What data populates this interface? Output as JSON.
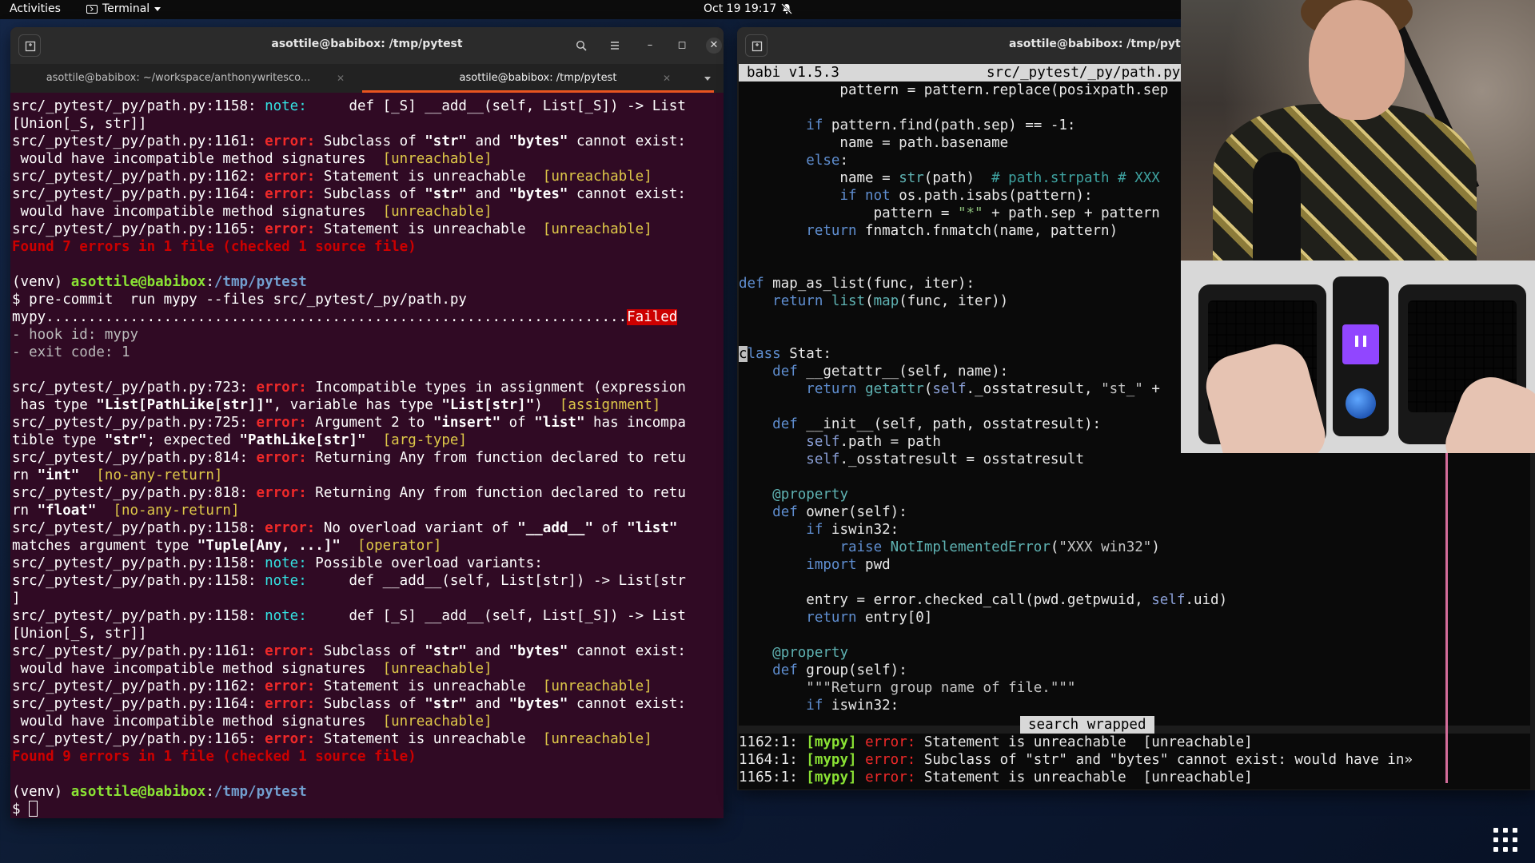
{
  "topbar": {
    "activities": "Activities",
    "app_menu": "Terminal",
    "clock": "Oct 19  19:17",
    "icons": [
      "terminal-icon",
      "bell-muted-icon"
    ]
  },
  "left_window": {
    "title": "asottile@babibox: /tmp/pytest",
    "tabs": [
      {
        "label": "asottile@babibox: ~/workspace/anthonywritesco..."
      },
      {
        "label": "asottile@babibox: /tmp/pytest",
        "active": true
      }
    ],
    "lines": [
      [
        [
          "w",
          "src/_pytest/_py/path.py:1158: "
        ],
        [
          "note",
          "note:"
        ],
        [
          "w",
          "     def [_S] __add__(self, List[_S]) -> List"
        ]
      ],
      [
        [
          "w",
          "[Union[_S, str]]"
        ]
      ],
      [
        [
          "w",
          "src/_pytest/_py/path.py:1161: "
        ],
        [
          "err",
          "error:"
        ],
        [
          "w",
          " Subclass of "
        ],
        [
          "bold",
          "\"str\""
        ],
        [
          "w",
          " and "
        ],
        [
          "bold",
          "\"bytes\""
        ],
        [
          "w",
          " cannot exist:"
        ]
      ],
      [
        [
          "w",
          " would have incompatible method signatures  "
        ],
        [
          "tag",
          "[unreachable]"
        ]
      ],
      [
        [
          "w",
          "src/_pytest/_py/path.py:1162: "
        ],
        [
          "err",
          "error:"
        ],
        [
          "w",
          " Statement is unreachable  "
        ],
        [
          "tag",
          "[unreachable]"
        ]
      ],
      [
        [
          "w",
          "src/_pytest/_py/path.py:1164: "
        ],
        [
          "err",
          "error:"
        ],
        [
          "w",
          " Subclass of "
        ],
        [
          "bold",
          "\"str\""
        ],
        [
          "w",
          " and "
        ],
        [
          "bold",
          "\"bytes\""
        ],
        [
          "w",
          " cannot exist:"
        ]
      ],
      [
        [
          "w",
          " would have incompatible method signatures  "
        ],
        [
          "tag",
          "[unreachable]"
        ]
      ],
      [
        [
          "w",
          "src/_pytest/_py/path.py:1165: "
        ],
        [
          "err",
          "error:"
        ],
        [
          "w",
          " Statement is unreachable  "
        ],
        [
          "tag",
          "[unreachable]"
        ]
      ],
      [
        [
          "found",
          "Found 7 errors in 1 file (checked 1 source file)"
        ]
      ],
      [
        [
          "w",
          ""
        ]
      ],
      [
        [
          "w",
          "(venv) "
        ],
        [
          "green",
          "asottile@babibox"
        ],
        [
          "w",
          ":"
        ],
        [
          "blue",
          "/tmp/pytest"
        ]
      ],
      [
        [
          "w",
          "$ pre-commit  run mypy --files src/_pytest/_py/path.py"
        ]
      ],
      [
        [
          "w",
          "mypy....................................................................."
        ],
        [
          "failed",
          "Failed"
        ]
      ],
      [
        [
          "dim",
          "- hook id: mypy"
        ]
      ],
      [
        [
          "dim",
          "- exit code: 1"
        ]
      ],
      [
        [
          "w",
          ""
        ]
      ],
      [
        [
          "w",
          "src/_pytest/_py/path.py:723: "
        ],
        [
          "err",
          "error:"
        ],
        [
          "w",
          " Incompatible types in assignment (expression"
        ]
      ],
      [
        [
          "w",
          " has type "
        ],
        [
          "bold",
          "\"List[PathLike[str]]\""
        ],
        [
          "w",
          ", variable has type "
        ],
        [
          "bold",
          "\"List[str]\""
        ],
        [
          "w",
          ")  "
        ],
        [
          "tag",
          "[assignment]"
        ]
      ],
      [
        [
          "w",
          "src/_pytest/_py/path.py:725: "
        ],
        [
          "err",
          "error:"
        ],
        [
          "w",
          " Argument 2 to "
        ],
        [
          "bold",
          "\"insert\""
        ],
        [
          "w",
          " of "
        ],
        [
          "bold",
          "\"list\""
        ],
        [
          "w",
          " has incompa"
        ]
      ],
      [
        [
          "w",
          "tible type "
        ],
        [
          "bold",
          "\"str\""
        ],
        [
          "w",
          "; expected "
        ],
        [
          "bold",
          "\"PathLike[str]\""
        ],
        [
          "w",
          "  "
        ],
        [
          "tag",
          "[arg-type]"
        ]
      ],
      [
        [
          "w",
          "src/_pytest/_py/path.py:814: "
        ],
        [
          "err",
          "error:"
        ],
        [
          "w",
          " Returning Any from function declared to retu"
        ]
      ],
      [
        [
          "w",
          "rn "
        ],
        [
          "bold",
          "\"int\""
        ],
        [
          "w",
          "  "
        ],
        [
          "tag",
          "[no-any-return]"
        ]
      ],
      [
        [
          "w",
          "src/_pytest/_py/path.py:818: "
        ],
        [
          "err",
          "error:"
        ],
        [
          "w",
          " Returning Any from function declared to retu"
        ]
      ],
      [
        [
          "w",
          "rn "
        ],
        [
          "bold",
          "\"float\""
        ],
        [
          "w",
          "  "
        ],
        [
          "tag",
          "[no-any-return]"
        ]
      ],
      [
        [
          "w",
          "src/_pytest/_py/path.py:1158: "
        ],
        [
          "err",
          "error:"
        ],
        [
          "w",
          " No overload variant of "
        ],
        [
          "bold",
          "\"__add__\""
        ],
        [
          "w",
          " of "
        ],
        [
          "bold",
          "\"list\""
        ]
      ],
      [
        [
          "w",
          "matches argument type "
        ],
        [
          "bold",
          "\"Tuple[Any, ...]\""
        ],
        [
          "w",
          "  "
        ],
        [
          "tag",
          "[operator]"
        ]
      ],
      [
        [
          "w",
          "src/_pytest/_py/path.py:1158: "
        ],
        [
          "note",
          "note:"
        ],
        [
          "w",
          " Possible overload variants:"
        ]
      ],
      [
        [
          "w",
          "src/_pytest/_py/path.py:1158: "
        ],
        [
          "note",
          "note:"
        ],
        [
          "w",
          "     def __add__(self, List[str]) -> List[str"
        ]
      ],
      [
        [
          "w",
          "]"
        ]
      ],
      [
        [
          "w",
          "src/_pytest/_py/path.py:1158: "
        ],
        [
          "note",
          "note:"
        ],
        [
          "w",
          "     def [_S] __add__(self, List[_S]) -> List"
        ]
      ],
      [
        [
          "w",
          "[Union[_S, str]]"
        ]
      ],
      [
        [
          "w",
          "src/_pytest/_py/path.py:1161: "
        ],
        [
          "err",
          "error:"
        ],
        [
          "w",
          " Subclass of "
        ],
        [
          "bold",
          "\"str\""
        ],
        [
          "w",
          " and "
        ],
        [
          "bold",
          "\"bytes\""
        ],
        [
          "w",
          " cannot exist:"
        ]
      ],
      [
        [
          "w",
          " would have incompatible method signatures  "
        ],
        [
          "tag",
          "[unreachable]"
        ]
      ],
      [
        [
          "w",
          "src/_pytest/_py/path.py:1162: "
        ],
        [
          "err",
          "error:"
        ],
        [
          "w",
          " Statement is unreachable  "
        ],
        [
          "tag",
          "[unreachable]"
        ]
      ],
      [
        [
          "w",
          "src/_pytest/_py/path.py:1164: "
        ],
        [
          "err",
          "error:"
        ],
        [
          "w",
          " Subclass of "
        ],
        [
          "bold",
          "\"str\""
        ],
        [
          "w",
          " and "
        ],
        [
          "bold",
          "\"bytes\""
        ],
        [
          "w",
          " cannot exist:"
        ]
      ],
      [
        [
          "w",
          " would have incompatible method signatures  "
        ],
        [
          "tag",
          "[unreachable]"
        ]
      ],
      [
        [
          "w",
          "src/_pytest/_py/path.py:1165: "
        ],
        [
          "err",
          "error:"
        ],
        [
          "w",
          " Statement is unreachable  "
        ],
        [
          "tag",
          "[unreachable]"
        ]
      ],
      [
        [
          "found",
          "Found 9 errors in 1 file (checked 1 source file)"
        ]
      ],
      [
        [
          "w",
          ""
        ]
      ],
      [
        [
          "w",
          "(venv) "
        ],
        [
          "green",
          "asottile@babibox"
        ],
        [
          "w",
          ":"
        ],
        [
          "blue",
          "/tmp/pytest"
        ]
      ],
      [
        [
          "w",
          "$ "
        ],
        [
          "cursor",
          ""
        ]
      ]
    ]
  },
  "right_window": {
    "title": "asottile@babibox: /tmp/pytest",
    "status_left": "babi v1.5.3",
    "status_file": "src/_pytest/_py/path.py",
    "code": [
      [
        [
          "fn",
          "            pattern = pattern.replace(posixpath.sep"
        ]
      ],
      [
        [
          "fn",
          ""
        ]
      ],
      [
        [
          "fn",
          "        "
        ],
        [
          "py-kw",
          "if"
        ],
        [
          "fn",
          " pattern.find(path.sep) == -1:"
        ]
      ],
      [
        [
          "fn",
          "            name = path.basename"
        ]
      ],
      [
        [
          "fn",
          "        "
        ],
        [
          "py-kw",
          "else"
        ],
        [
          "fn",
          ":"
        ]
      ],
      [
        [
          "fn",
          "            name = "
        ],
        [
          "builtin",
          "str"
        ],
        [
          "fn",
          "(path)  "
        ],
        [
          "cmt",
          "# path.strpath # XXX"
        ]
      ],
      [
        [
          "fn",
          "            "
        ],
        [
          "py-kw",
          "if not"
        ],
        [
          "fn",
          " os.path.isabs(pattern):"
        ]
      ],
      [
        [
          "fn",
          "                pattern = "
        ],
        [
          "strc",
          "\"*\""
        ],
        [
          "fn",
          " + path.sep + pattern"
        ]
      ],
      [
        [
          "fn",
          "        "
        ],
        [
          "py-kw",
          "return"
        ],
        [
          "fn",
          " fnmatch.fnmatch(name, pattern)"
        ]
      ],
      [
        [
          "fn",
          ""
        ]
      ],
      [
        [
          "fn",
          ""
        ]
      ],
      [
        [
          "py-kw",
          "def"
        ],
        [
          "fn",
          " map_as_list(func, iter):"
        ]
      ],
      [
        [
          "fn",
          "    "
        ],
        [
          "py-kw",
          "return"
        ],
        [
          "fn",
          " "
        ],
        [
          "builtin",
          "list"
        ],
        [
          "fn",
          "("
        ],
        [
          "builtin",
          "map"
        ],
        [
          "fn",
          "(func, iter))"
        ]
      ],
      [
        [
          "fn",
          ""
        ]
      ],
      [
        [
          "fn",
          ""
        ]
      ],
      [
        [
          "cur",
          "c"
        ],
        [
          "py-kw",
          "lass"
        ],
        [
          "fn",
          " Stat:"
        ]
      ],
      [
        [
          "fn",
          "    "
        ],
        [
          "py-kw",
          "def"
        ],
        [
          "fn",
          " __getattr__(self, name):"
        ]
      ],
      [
        [
          "fn",
          "        "
        ],
        [
          "py-kw",
          "return"
        ],
        [
          "fn",
          " "
        ],
        [
          "builtin",
          "getattr"
        ],
        [
          "fn",
          "("
        ],
        [
          "selfc",
          "self"
        ],
        [
          "fn",
          "._osstatresult, "
        ],
        [
          "str",
          "\"st_\""
        ],
        [
          "fn",
          " +"
        ]
      ],
      [
        [
          "fn",
          ""
        ]
      ],
      [
        [
          "fn",
          "    "
        ],
        [
          "py-kw",
          "def"
        ],
        [
          "fn",
          " __init__(self, path, osstatresult):"
        ]
      ],
      [
        [
          "fn",
          "        "
        ],
        [
          "selfc",
          "self"
        ],
        [
          "fn",
          ".path = path"
        ]
      ],
      [
        [
          "fn",
          "        "
        ],
        [
          "selfc",
          "self"
        ],
        [
          "fn",
          "._osstatresult = osstatresult"
        ]
      ],
      [
        [
          "fn",
          ""
        ]
      ],
      [
        [
          "fn",
          "    "
        ],
        [
          "builtin",
          "@property"
        ]
      ],
      [
        [
          "fn",
          "    "
        ],
        [
          "py-kw",
          "def"
        ],
        [
          "fn",
          " owner(self):"
        ]
      ],
      [
        [
          "fn",
          "        "
        ],
        [
          "py-kw",
          "if"
        ],
        [
          "fn",
          " iswin32:"
        ]
      ],
      [
        [
          "fn",
          "            "
        ],
        [
          "py-kw",
          "raise"
        ],
        [
          "fn",
          " "
        ],
        [
          "builtin",
          "NotImplementedError"
        ],
        [
          "fn",
          "("
        ],
        [
          "str",
          "\"XXX win32\""
        ],
        [
          "fn",
          ")"
        ]
      ],
      [
        [
          "fn",
          "        "
        ],
        [
          "py-kw",
          "import"
        ],
        [
          "fn",
          " pwd"
        ]
      ],
      [
        [
          "fn",
          ""
        ]
      ],
      [
        [
          "fn",
          "        entry = error.checked_call(pwd.getpwuid, "
        ],
        [
          "selfc",
          "self"
        ],
        [
          "fn",
          ".uid)"
        ]
      ],
      [
        [
          "fn",
          "        "
        ],
        [
          "py-kw",
          "return"
        ],
        [
          "fn",
          " entry[0]"
        ]
      ],
      [
        [
          "fn",
          ""
        ]
      ],
      [
        [
          "fn",
          "    "
        ],
        [
          "builtin",
          "@property"
        ]
      ],
      [
        [
          "fn",
          "    "
        ],
        [
          "py-kw",
          "def"
        ],
        [
          "fn",
          " group(self):"
        ]
      ],
      [
        [
          "fn",
          "        "
        ],
        [
          "str",
          "\"\"\"Return group name of file.\"\"\""
        ]
      ],
      [
        [
          "fn",
          "        "
        ],
        [
          "py-kw",
          "if"
        ],
        [
          "fn",
          " iswin32:"
        ]
      ]
    ],
    "search_status": "search wrapped",
    "problems": [
      [
        [
          "fn",
          "1162:1: "
        ],
        [
          "mypy",
          "[mypy]"
        ],
        [
          "fn",
          " "
        ],
        [
          "perr",
          "error:"
        ],
        [
          "fn",
          " Statement is unreachable  [unreachable]"
        ]
      ],
      [
        [
          "fn",
          "1164:1: "
        ],
        [
          "mypy",
          "[mypy]"
        ],
        [
          "fn",
          " "
        ],
        [
          "perr",
          "error:"
        ],
        [
          "fn",
          " Subclass of \"str\" and \"bytes\" cannot exist: would have in»"
        ]
      ],
      [
        [
          "fn",
          "1165:1: "
        ],
        [
          "mypy",
          "[mypy]"
        ],
        [
          "fn",
          " "
        ],
        [
          "perr",
          "error:"
        ],
        [
          "fn",
          " Statement is unreachable  [unreachable]"
        ]
      ]
    ]
  },
  "colors": {
    "terminal_bg": "#300a24",
    "accent": "#e95420"
  }
}
